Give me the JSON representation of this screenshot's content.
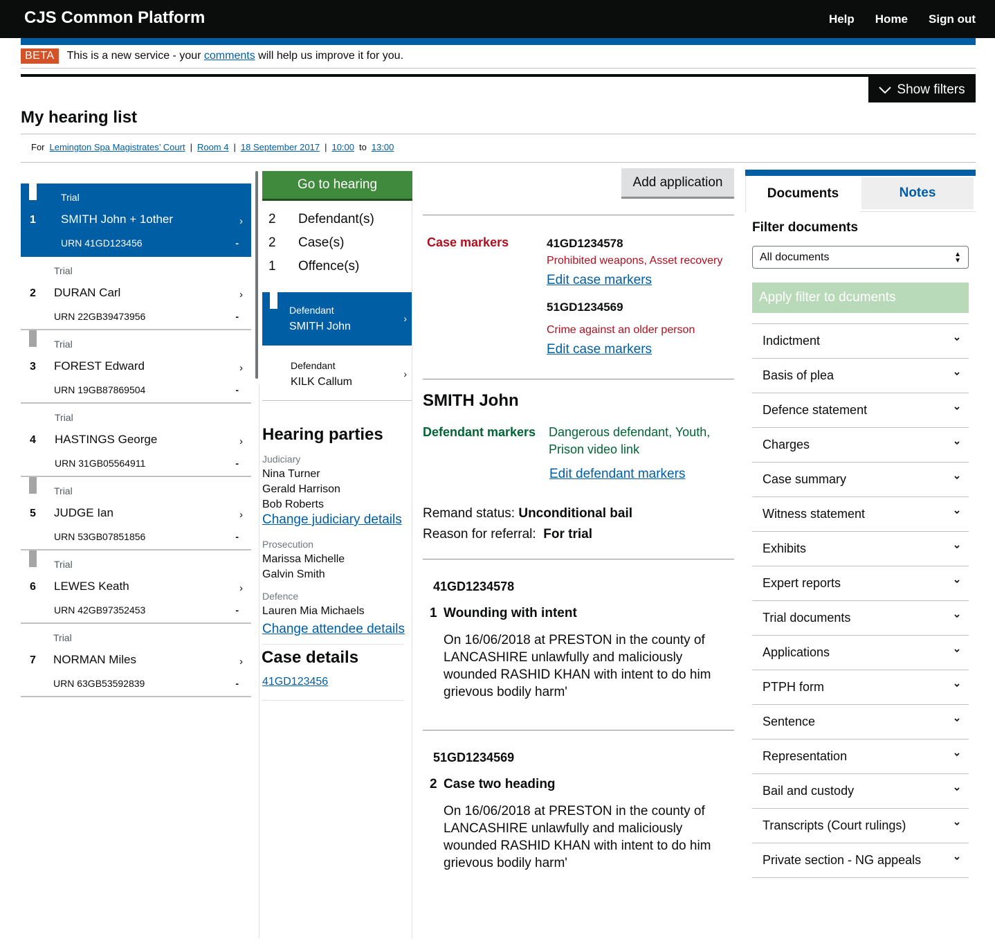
{
  "header": {
    "title": "CJS Common Platform",
    "nav": [
      "Help",
      "Home",
      "Sign out"
    ]
  },
  "beta": {
    "tag": "BETA",
    "text_before": "This is a new service - your",
    "link": "comments",
    "text_after": "will help us improve it for you."
  },
  "filters_button": "Show filters",
  "page_title": "My hearing list",
  "for_line": {
    "prefix": "For",
    "court": "Lemington Spa Magistrates’ Court",
    "sep": "|",
    "room": "Room 4",
    "date": "18 September 2017",
    "time_from": "10:00",
    "to": "to",
    "time_to": "13:00"
  },
  "hearings": [
    {
      "num": "1",
      "type": "Trial",
      "name": "SMITH John + 1other",
      "urn_label": "URN",
      "urn": "41GD123456",
      "dash": "-"
    },
    {
      "num": "2",
      "type": "Trial",
      "name": "DURAN Carl",
      "urn_label": "URN",
      "urn": "22GB39473956",
      "dash": "-"
    },
    {
      "num": "3",
      "type": "Trial",
      "name": "FOREST Edward",
      "urn_label": "URN",
      "urn": "19GB87869504",
      "dash": "-"
    },
    {
      "num": "4",
      "type": "Trial",
      "name": "HASTINGS George",
      "urn_label": "URN",
      "urn": "31GB05564911",
      "dash": "-"
    },
    {
      "num": "5",
      "type": "Trial",
      "name": "JUDGE Ian",
      "urn_label": "URN",
      "urn": "53GB07851856",
      "dash": "-"
    },
    {
      "num": "6",
      "type": "Trial",
      "name": "LEWES Keath",
      "urn_label": "URN",
      "urn": "42GB97352453",
      "dash": "-"
    },
    {
      "num": "7",
      "type": "Trial",
      "name": "NORMAN Miles",
      "urn_label": "URN",
      "urn": "63GB53592839",
      "dash": "-"
    }
  ],
  "middle": {
    "go_to_hearing": "Go to hearing",
    "counts": [
      {
        "n": "2",
        "label": "Defendant(s)"
      },
      {
        "n": "2",
        "label": "Case(s)"
      },
      {
        "n": "1",
        "label": "Offence(s)"
      }
    ],
    "defendants": [
      {
        "label": "Defendant",
        "name": "SMITH John"
      },
      {
        "label": "Defendant",
        "name": "KILK Callum"
      }
    ],
    "hearing_parties": {
      "title": "Hearing parties",
      "judiciary_label": "Judiciary",
      "judiciary": [
        "Nina Turner",
        "Gerald Harrison",
        "Bob Roberts"
      ],
      "change_judiciary": "Change judiciary details",
      "prosecution_label": "Prosecution",
      "prosecution": [
        "Marissa Michelle",
        "Galvin Smith"
      ],
      "defence_label": "Defence",
      "defence": [
        "Lauren Mia Michaels"
      ],
      "change_attendee": "Change attendee details"
    },
    "case_details": {
      "title": "Case details",
      "link": "41GD123456"
    }
  },
  "details": {
    "add_application": "Add application",
    "case_markers_label": "Case markers",
    "case_markers": [
      {
        "urn": "41GD1234578",
        "markers": "Prohibited weapons, Asset recovery",
        "edit": "Edit case markers"
      },
      {
        "urn": "51GD1234569",
        "markers": "Crime against an older person",
        "edit": "Edit case markers"
      }
    ],
    "defendant_name": "SMITH John",
    "defendant_markers_label": "Defendant markers",
    "defendant_markers": "Dangerous defendant, Youth, Prison video link",
    "edit_defendant_markers": "Edit defendant markers",
    "remand_label": "Remand status:",
    "remand_value": "Unconditional bail",
    "referral_label": "Reason for referral:",
    "referral_value": "For trial",
    "offences": [
      {
        "urn": "41GD1234578",
        "num": "1",
        "heading": "Wounding with intent",
        "description": "On 16/06/2018 at PRESTON in the county of LANCASHIRE unlawfully and maliciously wounded RASHID KHAN with intent to do him grievous bodily harm'"
      },
      {
        "urn": "51GD1234569",
        "num": "2",
        "heading": "Case two heading",
        "description": "On 16/06/2018 at PRESTON in the county of LANCASHIRE unlawfully and maliciously wounded RASHID KHAN with intent to do him grievous bodily harm'"
      }
    ]
  },
  "documents_panel": {
    "tab_documents": "Documents",
    "tab_notes": "Notes",
    "filter_title": "Filter documents",
    "filter_selected": "All documents",
    "apply_filter": "Apply filter to dcuments",
    "items": [
      "Indictment",
      "Basis of plea",
      "Defence statement",
      "Charges",
      "Case summary",
      "Witness statement",
      "Exhibits",
      "Expert reports",
      "Trial documents",
      "Applications",
      "PTPH form",
      "Sentence",
      "Representation",
      "Bail and custody",
      "Transcripts (Court rulings)",
      "Private section - NG appeals"
    ]
  },
  "colors": {
    "brand_blue": "#005ea5",
    "header_black": "#0b0c0c",
    "go_green": "#3f8a3c",
    "marker_red": "#b10e1e",
    "marker_green": "#006435",
    "beta_orange": "#d35227"
  }
}
